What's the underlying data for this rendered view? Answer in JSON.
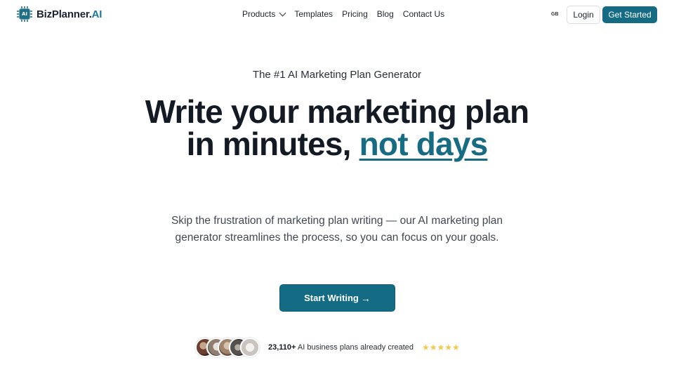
{
  "brand": {
    "name_main": "BizPlanner.",
    "name_accent": "AI",
    "logo_chip_text": "AI"
  },
  "nav": {
    "items": [
      {
        "label": "Products",
        "has_dropdown": true
      },
      {
        "label": "Templates"
      },
      {
        "label": "Pricing"
      },
      {
        "label": "Blog"
      },
      {
        "label": "Contact Us"
      }
    ],
    "language": "GB",
    "login_label": "Login",
    "get_started_label": "Get Started"
  },
  "hero": {
    "eyebrow": "The #1 AI Marketing Plan Generator",
    "headline_main": "Write your marketing plan in minutes, ",
    "headline_accent": "not days",
    "subheadline": "Skip the frustration of marketing plan writing — our AI marketing plan generator streamlines the process, so you can focus on your goals.",
    "cta_label": "Start Writing",
    "cta_arrow": "→"
  },
  "social_proof": {
    "count": "23,110+",
    "text": " AI business plans already created",
    "stars": "★★★★★",
    "rating_stars": 5,
    "avatar_count": 5
  },
  "colors": {
    "accent": "#146c84",
    "star": "#f2c94c",
    "text": "#141a24"
  }
}
